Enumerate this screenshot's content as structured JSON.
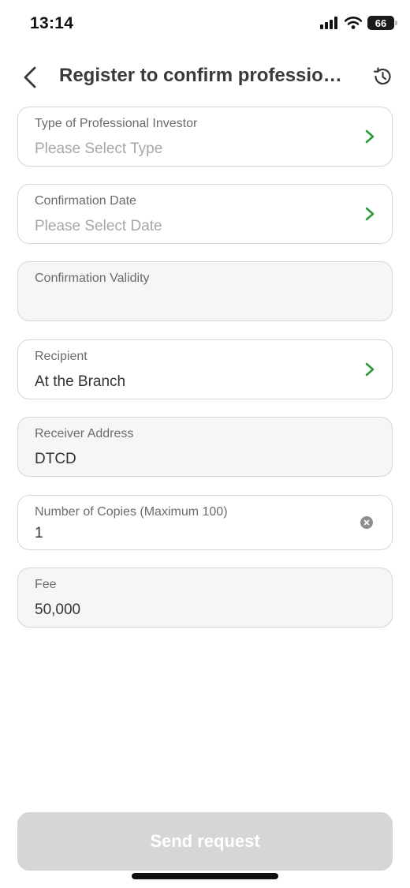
{
  "status_bar": {
    "time": "13:14",
    "battery": "66"
  },
  "header": {
    "title": "Register to confirm professional investor",
    "back_icon": "chevron-left-icon",
    "history_icon": "history-icon"
  },
  "form": {
    "investor_type": {
      "label": "Type of Professional Investor",
      "placeholder": "Please Select Type"
    },
    "confirmation_date": {
      "label": "Confirmation Date",
      "placeholder": "Please Select Date"
    },
    "confirmation_validity": {
      "label": "Confirmation Validity",
      "value": ""
    },
    "recipient": {
      "label": "Recipient",
      "value": "At the Branch"
    },
    "receiver_address": {
      "label": "Receiver Address",
      "value": "DTCD"
    },
    "number_of_copies": {
      "label": "Number of Copies (Maximum 100)",
      "value": "1"
    },
    "fee": {
      "label": "Fee",
      "value": "50,000"
    }
  },
  "footer": {
    "send_label": "Send request"
  },
  "colors": {
    "accent_green": "#2e9a3a",
    "disabled_button": "#d6d6d6",
    "field_border": "#d6d6d6",
    "readonly_bg": "#f6f6f6"
  }
}
